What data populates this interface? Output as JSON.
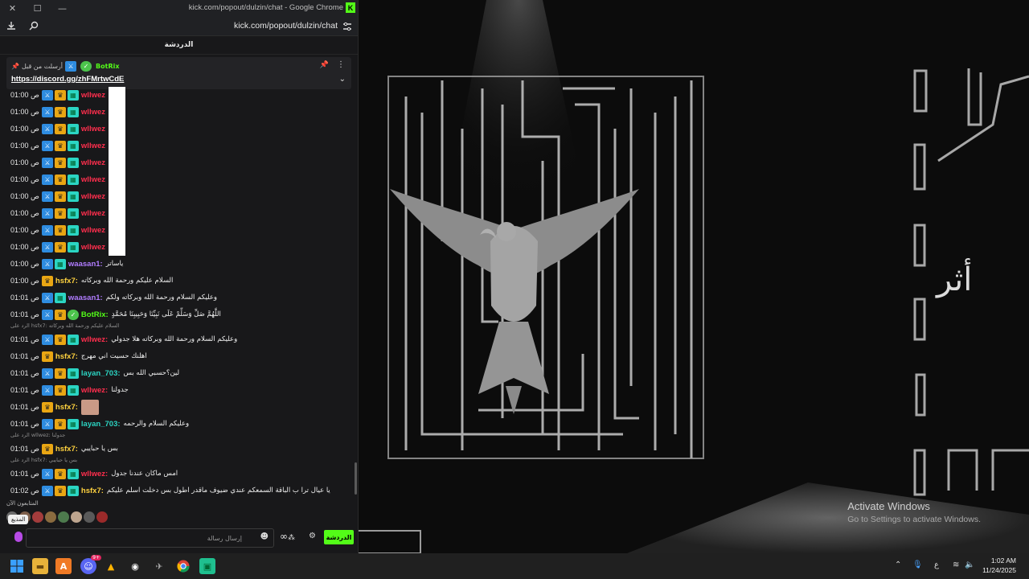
{
  "window": {
    "title": "kick.com/popout/dulzin/chat - Google Chrome",
    "url": "kick.com/popout/dulzin/chat"
  },
  "chat": {
    "header": "الدردشة",
    "pinned": {
      "sent_by": "أرسلت من قبل",
      "author": "BotRix",
      "link": "https://discord.gg/zhFMrtwCdE"
    },
    "messages": [
      {
        "time": "01:00 ص",
        "badges": [
          "mod",
          "crown",
          "sub"
        ],
        "user": "wllwez",
        "color": "#ff2e4d",
        "text": ""
      },
      {
        "time": "01:00 ص",
        "badges": [
          "mod",
          "crown",
          "sub"
        ],
        "user": "wllwez",
        "color": "#ff2e4d",
        "text": ""
      },
      {
        "time": "01:00 ص",
        "badges": [
          "mod",
          "crown",
          "sub"
        ],
        "user": "wllwez",
        "color": "#ff2e4d",
        "text": ""
      },
      {
        "time": "01:00 ص",
        "badges": [
          "mod",
          "crown",
          "sub"
        ],
        "user": "wllwez",
        "color": "#ff2e4d",
        "text": ""
      },
      {
        "time": "01:00 ص",
        "badges": [
          "mod",
          "crown",
          "sub"
        ],
        "user": "wllwez",
        "color": "#ff2e4d",
        "text": ""
      },
      {
        "time": "01:00 ص",
        "badges": [
          "mod",
          "crown",
          "sub"
        ],
        "user": "wllwez",
        "color": "#ff2e4d",
        "text": ""
      },
      {
        "time": "01:00 ص",
        "badges": [
          "mod",
          "crown",
          "sub"
        ],
        "user": "wllwez",
        "color": "#ff2e4d",
        "text": ""
      },
      {
        "time": "01:00 ص",
        "badges": [
          "mod",
          "crown",
          "sub"
        ],
        "user": "wllwez",
        "color": "#ff2e4d",
        "text": ""
      },
      {
        "time": "01:00 ص",
        "badges": [
          "mod",
          "crown",
          "sub"
        ],
        "user": "wllwez",
        "color": "#ff2e4d",
        "text": ""
      },
      {
        "time": "01:00 ص",
        "badges": [
          "mod",
          "crown",
          "sub"
        ],
        "user": "wllwez",
        "color": "#ff2e4d",
        "text": ""
      },
      {
        "time": "01:00 ص",
        "badges": [
          "mod",
          "sub"
        ],
        "user": "waasan1:",
        "color": "#b07cff",
        "text": "ياساتر"
      },
      {
        "time": "01:00 ص",
        "badges": [
          "crown"
        ],
        "user": "hsfx7:",
        "color": "#ffd23f",
        "text": "السلام عليكم ورحمة الله وبركاته"
      },
      {
        "time": "01:01 ص",
        "badges": [
          "mod",
          "sub"
        ],
        "user": "waasan1:",
        "color": "#b07cff",
        "text": "وعليكم السلام ورحمة الله وبركاته ولكم"
      },
      {
        "time": "01:01 ص",
        "badges": [
          "mod",
          "crown",
          "bot"
        ],
        "user": "BotRix:",
        "color": "#53fc18",
        "text": "اللَّهُمَّ صَلِّ وَسَلِّمْ عَلَى نَبِيِّنَا وَحَبِيبِنَا مُحَمَّدٍ"
      },
      {
        "time": "01:01 ص",
        "badges": [
          "mod",
          "crown",
          "sub"
        ],
        "user": "wllwez:",
        "color": "#ff2e4d",
        "text": "وعليكم السلام ورحمة الله وبركاته هلا جدولي",
        "reply": "الرد على hsfx7: السلام عليكم ورحمة الله وبركاته"
      },
      {
        "time": "01:01 ص",
        "badges": [
          "crown"
        ],
        "user": "hsfx7:",
        "color": "#ffd23f",
        "text": "اهلنك حسيت اني مهرج"
      },
      {
        "time": "01:01 ص",
        "badges": [
          "mod",
          "crown",
          "sub"
        ],
        "user": "layan_703:",
        "color": "#2bd5c3",
        "text": "لين؟حسبي الله بس"
      },
      {
        "time": "01:01 ص",
        "badges": [
          "mod",
          "crown",
          "sub"
        ],
        "user": "wllwez:",
        "color": "#ff2e4d",
        "text": "جدولنا"
      },
      {
        "time": "01:01 ص",
        "badges": [
          "crown"
        ],
        "user": "hsfx7:",
        "color": "#ffd23f",
        "text": ""
      },
      {
        "time": "01:01 ص",
        "badges": [
          "mod",
          "crown",
          "sub"
        ],
        "user": "layan_703:",
        "color": "#2bd5c3",
        "text": "وعليكم السلام والرحمه"
      },
      {
        "time": "01:01 ص",
        "badges": [
          "crown"
        ],
        "user": "hsfx7:",
        "color": "#ffd23f",
        "text": "بس يا حبايبي",
        "reply": "الرد على wllwez: جدولنا"
      },
      {
        "time": "01:01 ص",
        "badges": [
          "mod",
          "crown",
          "sub"
        ],
        "user": "wllwez:",
        "color": "#ff2e4d",
        "text": "امس ماكان عندنا جدول",
        "reply": "الرد على hsfx7: بس يا حبايبي"
      },
      {
        "time": "01:02 ص",
        "badges": [
          "mod",
          "crown",
          "sub"
        ],
        "user": "hsfx7:",
        "color": "#ffd23f",
        "text": "يا عيال ترا ب الباقة السمعكم عندي ضيوف ماقدر اطول بس دخلت اسلم عليكم"
      }
    ],
    "viewers_label": "المتابعون الآن",
    "tooltip": "المذيع",
    "input_placeholder": "إرسال رسالة",
    "send_label": "الدردشة"
  },
  "background": {
    "side_text": "أثر"
  },
  "watermark": {
    "line1": "Activate Windows",
    "line2": "Go to Settings to activate Windows."
  },
  "taskbar": {
    "time": "1:02 AM",
    "date": "11/24/2025",
    "lang": "ع",
    "discord_badge": "9+"
  },
  "colors": {
    "kick_green": "#53fc18",
    "chat_bg": "#18181a"
  }
}
